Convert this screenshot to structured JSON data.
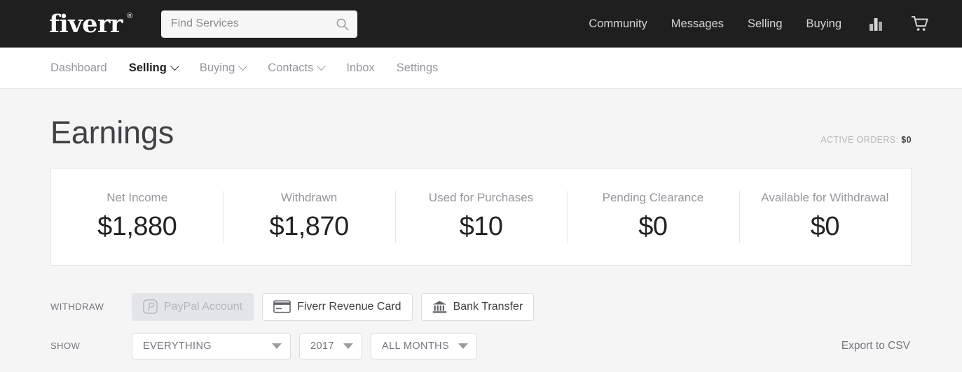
{
  "header": {
    "logo": "fiverr",
    "logo_mark": "®",
    "search": {
      "placeholder": "Find Services",
      "value": "",
      "icon": "search-icon"
    },
    "nav": [
      {
        "label": "Community"
      },
      {
        "label": "Messages"
      },
      {
        "label": "Selling"
      },
      {
        "label": "Buying"
      }
    ],
    "icons": [
      {
        "name": "analytics-bar-chart-icon"
      },
      {
        "name": "shopping-cart-icon"
      }
    ]
  },
  "subnav": {
    "items": [
      {
        "label": "Dashboard",
        "active": false,
        "caret": false
      },
      {
        "label": "Selling",
        "active": true,
        "caret": true
      },
      {
        "label": "Buying",
        "active": false,
        "caret": true
      },
      {
        "label": "Contacts",
        "active": false,
        "caret": true
      },
      {
        "label": "Inbox",
        "active": false,
        "caret": false
      },
      {
        "label": "Settings",
        "active": false,
        "caret": false
      }
    ]
  },
  "main": {
    "page_title": "Earnings",
    "active_orders": {
      "label": "ACTIVE ORDERS:",
      "value": "$0"
    },
    "stats": [
      {
        "label": "Net Income",
        "value": "$1,880"
      },
      {
        "label": "Withdrawn",
        "value": "$1,870"
      },
      {
        "label": "Used for Purchases",
        "value": "$10"
      },
      {
        "label": "Pending Clearance",
        "value": "$0"
      },
      {
        "label": "Available for Withdrawal",
        "value": "$0"
      }
    ],
    "withdraw": {
      "label": "WITHDRAW",
      "options": [
        {
          "label": "PayPal Account",
          "icon": "paypal-icon",
          "disabled": true
        },
        {
          "label": "Fiverr Revenue Card",
          "icon": "credit-card-icon",
          "disabled": false
        },
        {
          "label": "Bank Transfer",
          "icon": "bank-icon",
          "disabled": false
        }
      ]
    },
    "show": {
      "label": "SHOW",
      "filters": [
        {
          "name": "type",
          "value": "EVERYTHING"
        },
        {
          "name": "year",
          "value": "2017"
        },
        {
          "name": "month",
          "value": "ALL MONTHS"
        }
      ],
      "export_label": "Export to CSV"
    }
  },
  "colors": {
    "header_bg": "#1f1f1f",
    "page_bg": "#f5f5f5",
    "card_bg": "#ffffff",
    "border": "#e4e5e7",
    "text_primary": "#404145",
    "text_muted": "#95979d"
  }
}
